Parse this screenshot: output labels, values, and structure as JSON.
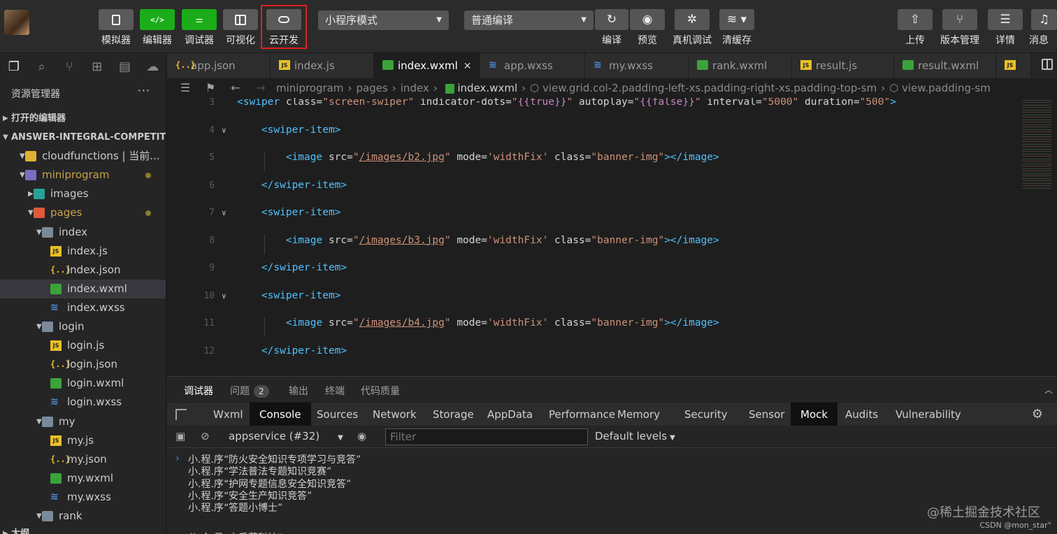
{
  "toolbar": {
    "left_buttons": [
      {
        "label": "模拟器",
        "icon": "phone-icon",
        "active": false
      },
      {
        "label": "编辑器",
        "icon": "code-icon",
        "active": true
      },
      {
        "label": "调试器",
        "icon": "sliders-icon",
        "active": true
      },
      {
        "label": "可视化",
        "icon": "layout-icon",
        "active": false
      },
      {
        "label": "云开发",
        "icon": "cloud-icon",
        "active": false
      }
    ],
    "mode_select": "小程序模式",
    "compile_select": "普通编译",
    "compile_label": "编译",
    "preview_label": "预览",
    "real_debug_label": "真机调试",
    "clear_cache_label": "清缓存",
    "upload_label": "上传",
    "version_label": "版本管理",
    "details_label": "详情",
    "messages_label": "消息"
  },
  "sidebar": {
    "title": "资源管理器",
    "more": "···",
    "open_editors": "打开的编辑器",
    "project": "ANSWER-INTEGRAL-COMPETITI...",
    "tree": [
      {
        "label": "cloudfunctions | 当前...",
        "type": "folder-cloud",
        "depth": 1,
        "expanded": true,
        "dot": false
      },
      {
        "label": "miniprogram",
        "type": "folder-mini",
        "depth": 1,
        "expanded": true,
        "dot": true,
        "color": "#c8a24a"
      },
      {
        "label": "images",
        "type": "folder-img",
        "depth": 2,
        "expanded": false,
        "dot": false
      },
      {
        "label": "pages",
        "type": "folder-pages",
        "depth": 2,
        "expanded": true,
        "dot": true,
        "color": "#c8a24a"
      },
      {
        "label": "index",
        "type": "folder-plain",
        "depth": 3,
        "expanded": true,
        "dot": false
      },
      {
        "label": "index.js",
        "type": "js",
        "depth": 4
      },
      {
        "label": "index.json",
        "type": "json",
        "depth": 4
      },
      {
        "label": "index.wxml",
        "type": "wxml",
        "depth": 4,
        "selected": true
      },
      {
        "label": "index.wxss",
        "type": "wxss",
        "depth": 4
      },
      {
        "label": "login",
        "type": "folder-plain",
        "depth": 3,
        "expanded": true
      },
      {
        "label": "login.js",
        "type": "js",
        "depth": 4
      },
      {
        "label": "login.json",
        "type": "json",
        "depth": 4
      },
      {
        "label": "login.wxml",
        "type": "wxml",
        "depth": 4
      },
      {
        "label": "login.wxss",
        "type": "wxss",
        "depth": 4
      },
      {
        "label": "my",
        "type": "folder-plain",
        "depth": 3,
        "expanded": true
      },
      {
        "label": "my.js",
        "type": "js",
        "depth": 4
      },
      {
        "label": "my.json",
        "type": "json",
        "depth": 4
      },
      {
        "label": "my.wxml",
        "type": "wxml",
        "depth": 4
      },
      {
        "label": "my.wxss",
        "type": "wxss",
        "depth": 4
      },
      {
        "label": "rank",
        "type": "folder-plain",
        "depth": 3,
        "expanded": true
      }
    ],
    "outline": "大纲"
  },
  "tabs": [
    {
      "label": "app.json",
      "type": "json",
      "active": false
    },
    {
      "label": "index.js",
      "type": "js",
      "active": false
    },
    {
      "label": "index.wxml",
      "type": "wxml",
      "active": true
    },
    {
      "label": "app.wxss",
      "type": "wxss",
      "active": false
    },
    {
      "label": "my.wxss",
      "type": "wxss",
      "active": false
    },
    {
      "label": "rank.wxml",
      "type": "wxml",
      "active": false
    },
    {
      "label": "result.js",
      "type": "js",
      "active": false
    },
    {
      "label": "result.wxml",
      "type": "wxml",
      "active": false
    },
    {
      "label": "",
      "type": "js",
      "active": false
    }
  ],
  "breadcrumb": {
    "parts": [
      "miniprogram",
      "pages",
      "index"
    ],
    "file": "index.wxml",
    "sel1": "view.grid.col-2.padding-left-xs.padding-right-xs.padding-top-sm",
    "sel2": "view.padding-sm"
  },
  "code": {
    "swiper": {
      "num": "3",
      "class": "screen-swiper",
      "dots": "{{true}}",
      "autoplay": "{{false}}",
      "interval": "5000",
      "duration": "500"
    },
    "items": [
      {
        "open": "4",
        "img": "5",
        "close": "6",
        "src": "/images/b2.jpg"
      },
      {
        "open": "7",
        "img": "8",
        "close": "9",
        "src": "/images/b3.jpg"
      },
      {
        "open": "10",
        "img": "11",
        "close": "12",
        "src": "/images/b4.jpg"
      }
    ],
    "mode": "widthFix",
    "img_class": "banner-img"
  },
  "panel": {
    "tabs": [
      {
        "label": "调试器",
        "active": true
      },
      {
        "label": "问题",
        "badge": "2"
      },
      {
        "label": "输出"
      },
      {
        "label": "终端"
      },
      {
        "label": "代码质量"
      }
    ],
    "devtools": [
      "Wxml",
      "Console",
      "Sources",
      "Network",
      "Storage",
      "AppData",
      "Performance",
      "Memory",
      "Security",
      "Sensor",
      "Mock",
      "Audits",
      "Vulnerability"
    ],
    "dark_tabs": [
      "Console",
      "Mock"
    ],
    "context": "appservice (#32)",
    "filter_placeholder": "Filter",
    "levels": "Default levels",
    "output": [
      "小.程.序“防火安全知识专项学习与竞答”",
      "小.程.序“学法普法专题知识竞赛”",
      "小.程.序“护网专题信息安全知识竞答”",
      "小.程.序“安全生产知识竞答”",
      "小.程.序“答题小博士”",
      "",
      "公.众.号“木番薯科技”"
    ]
  },
  "watermark": {
    "main": "@稀土掘金技术社区",
    "sub": "CSDN @mon_star°"
  }
}
